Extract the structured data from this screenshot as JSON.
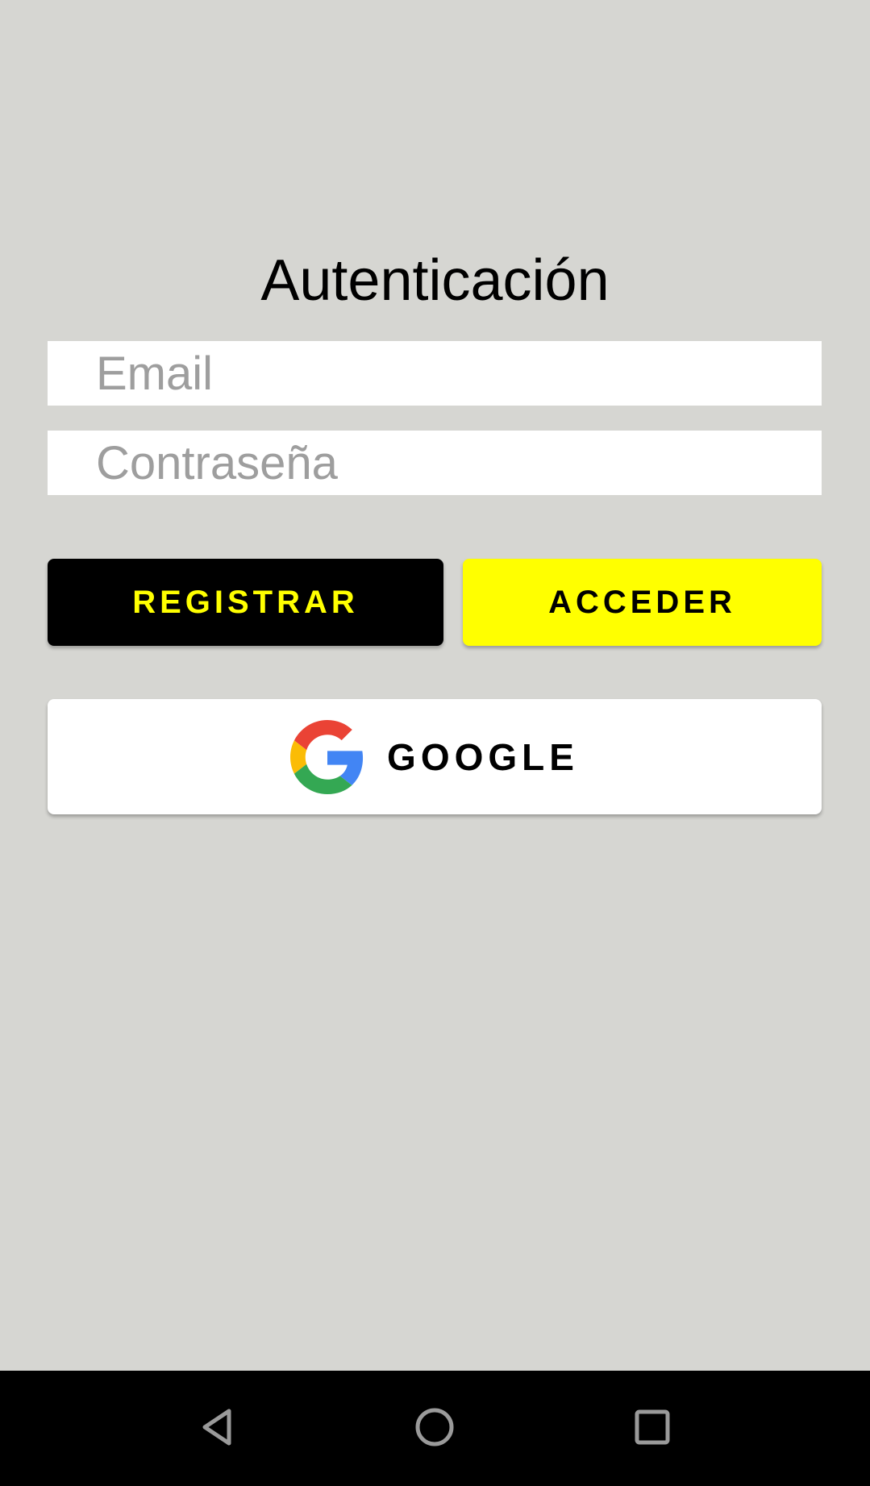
{
  "screen": {
    "title": "Autenticación"
  },
  "form": {
    "email_placeholder": "Email",
    "password_placeholder": "Contraseña"
  },
  "buttons": {
    "register_label": "REGISTRAR",
    "login_label": "ACCEDER",
    "google_label": "GOOGLE"
  },
  "colors": {
    "background": "#d6d6d2",
    "register_bg": "#000000",
    "register_text": "#ffff00",
    "login_bg": "#ffff00",
    "login_text": "#000000",
    "google_bg": "#ffffff",
    "navbar_bg": "#000000"
  },
  "icons": {
    "google": "google-g-icon",
    "nav_back": "back-triangle-icon",
    "nav_home": "home-circle-icon",
    "nav_recent": "recent-square-icon"
  }
}
